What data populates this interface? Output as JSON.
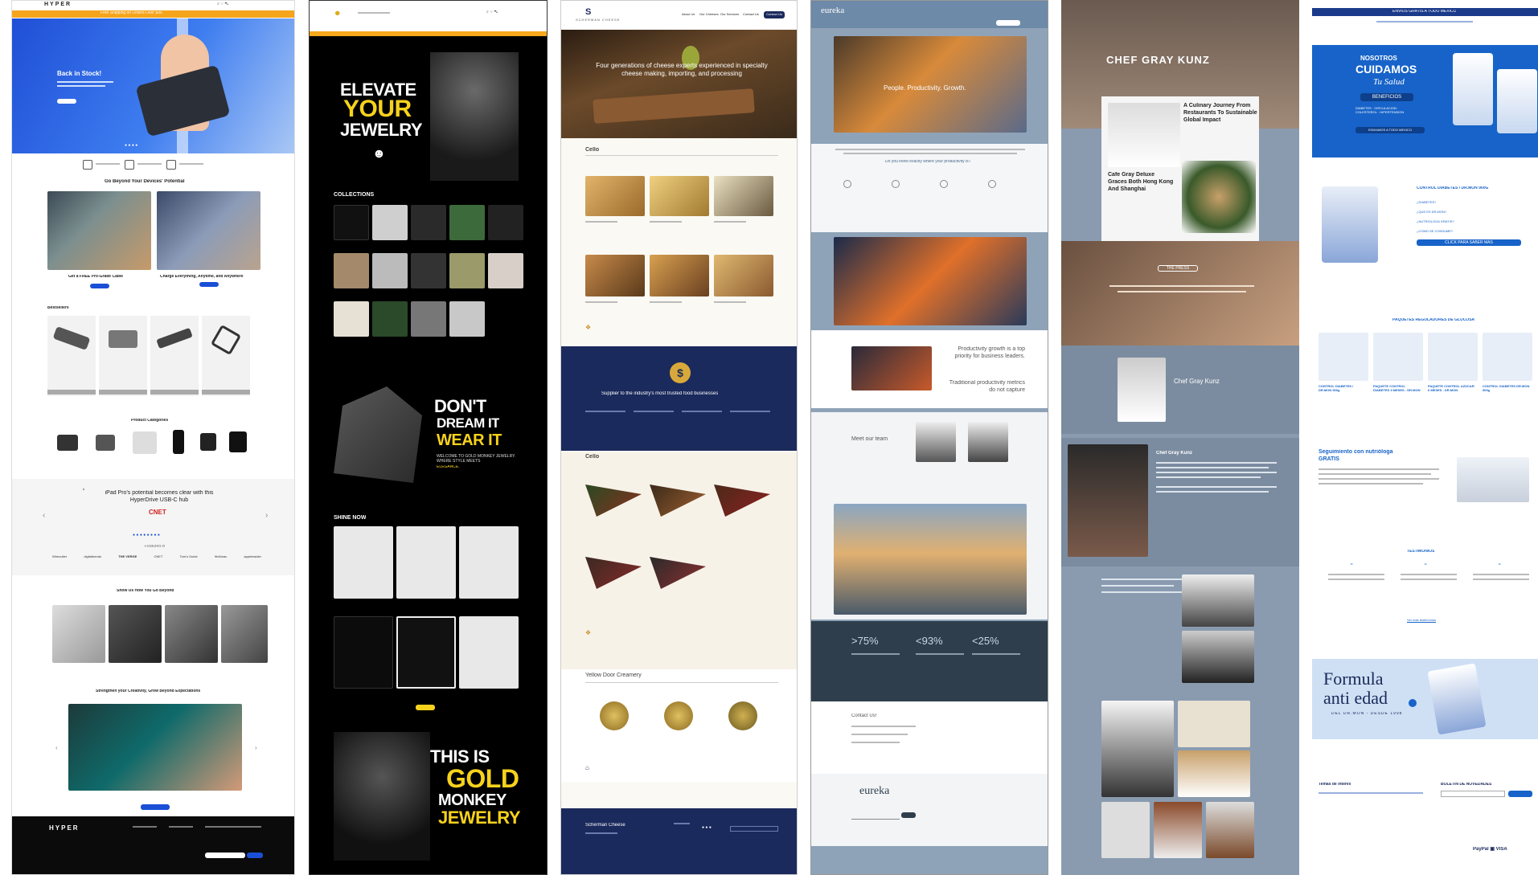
{
  "c1": {
    "brand": "HYPER",
    "promo": "Free Shipping on Orders Over $99",
    "hero_title": "Back in Stock!",
    "s1_title": "Go Beyond Your Devices' Potential",
    "card1": "Get a FREE Pro-Grade Cable",
    "card2": "Charge Everything, Anytime, and Anywhere",
    "bestsellers": "Bestsellers",
    "categories": "Product Categories",
    "quote": "iPad Pro's potential becomes clear with this HyperDrive USB-C hub",
    "quote_src": "CNET",
    "featured": "Featured in",
    "press": [
      "Wirecutter",
      "digitaltrends",
      "THE VERGE",
      "CNET",
      "Tom's Guide",
      "9to5mac",
      "appleinsider"
    ],
    "show_title": "Show Us How You Go Beyond",
    "strengthen": "Strengthen your Creativity, Grow Beyond Expectations",
    "footer_brand": "HYPER",
    "accent": "#1a4fd6",
    "promo_color": "#f5a51c"
  },
  "c2": {
    "elevate1": "ELEVATE",
    "elevate2": "YOUR",
    "elevate3": "JEWELRY",
    "collections": "COLLECTIONS",
    "dont1": "DON'T",
    "dont2": "DREAM IT",
    "dont3": "WEAR IT",
    "welcome": "WELCOME TO GOLD MONKEY JEWELRY. WHERE STYLE MEETS",
    "elegance": "ELEGANCE.",
    "shine": "SHINE NOW",
    "this1": "THIS IS",
    "this2": "GOLD",
    "this3": "MONKEY",
    "this4": "JEWELRY",
    "gold": "#f7d21c"
  },
  "c3": {
    "brand": "SCHERMAN CHEESE",
    "nav": [
      "About Us",
      "Our Cheeses",
      "Our Services",
      "Contact Us"
    ],
    "cta": "Contact Us",
    "hero_text": "Four generations of cheese experts experienced in specialty cheese making, importing, and processing",
    "cello1": "Cello",
    "supplier": "Supplier to the industry's most trusted food businesses",
    "cello2": "Cello",
    "yellow": "Yellow Door Creamery",
    "footer_brand": "Scherman Cheese",
    "navy": "#1b2a5c",
    "gold": "#d8a93a"
  },
  "c4": {
    "brand": "eureka",
    "hero_text": "People. Productivity. Growth.",
    "question": "Do you know exactly where your productivity is?",
    "prod_text": "Productivity growth is a top priority for business leaders.",
    "trad_text": "Traditional productivity metrics do not capture",
    "team": "Meet our team",
    "stat1": ">75%",
    "stat2": "<93%",
    "stat3": "<25%",
    "contact": "Contact Us!",
    "footer_brand": "eureka"
  },
  "c5": {
    "title": "CHEF GRAY KUNZ",
    "journey": "A Culinary Journey From Restaurants To Sustainable Global Impact",
    "cafe": "Cafe Gray Deluxe Graces Both Hong Kong And Shanghai",
    "press": "THE PRESS",
    "chef_name": "Chef Gray Kunz",
    "bio_title": "Chef Gray Kunz"
  },
  "c6": {
    "top_bar": "ENVIOS GRATIS A TODO MEXICO",
    "hero1": "NOSOTROS",
    "hero2": "CUIDAMOS",
    "hero3": "Tu Salud",
    "benefits": "BENEFICIOS",
    "benefit_list": "DIABETES · CIRCULACION · COLESTEROL · HIPERTENSION",
    "ship": "ENVIAMOS A TODO MEXICO",
    "control": "CONTROL DIABETES / DR.MON 900G",
    "q1": "¿DIABETES?",
    "q2": "¿QUE ES DR.MON?",
    "q3": "¿NUTRIOLOGA GRATIS?",
    "q4": "¿COMO SE CONSUME?",
    "click": "CLICK PARA SABER MAS",
    "paquetes": "PAQUETES REGULADORES DE GLUCOSA",
    "pack_names": [
      "CONTROL DIABETES / DR.MON 900g",
      "PAQUETE CONTROL DIABETES 3 MESES - DR.MON",
      "PAQUETE CONTROL AZUCAR 6 MESES - DR.MON",
      "CONTROL DIABETES DR.MON 900g"
    ],
    "nutri": "Seguimiento con nutrióloga GRATIS",
    "testimonios": "TESTIMONIOS",
    "more_test": "Ver más testimonios",
    "formula1": "Formula",
    "formula2": "anti edad",
    "formula3": "DEL DR.MON - DESDE 1998",
    "temas": "Temas de interes",
    "boletin": "BOLETIN DE NOVEDADES",
    "blue": "#1763c9"
  }
}
